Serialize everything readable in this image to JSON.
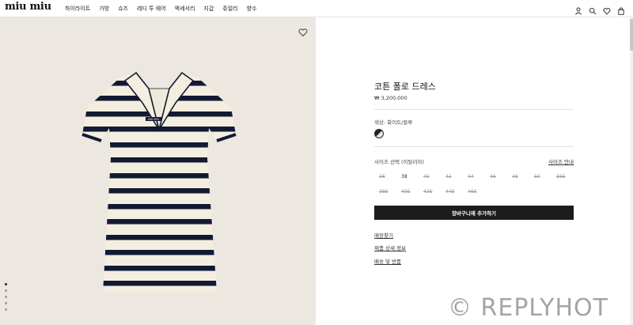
{
  "header": {
    "logo": "miu miu",
    "nav": [
      "하이라이트",
      "가방",
      "슈즈",
      "레디 투 웨어",
      "액세서리",
      "지갑",
      "쥬얼리",
      "향수"
    ],
    "icons": [
      "user-icon",
      "search-icon",
      "heart-icon",
      "bag-icon"
    ]
  },
  "product": {
    "title": "코튼 폴로 드레스",
    "price": "₩ 3,200,000",
    "color_label": "색상: 화이트/블루",
    "swatch_colors": [
      "#1b2238",
      "#e9e4d8"
    ],
    "size_label": "사이즈 선택 (이탈리아)",
    "size_guide": "사이즈 안내",
    "sizes_row1": [
      {
        "label": "36",
        "available": false
      },
      {
        "label": "38",
        "available": true
      },
      {
        "label": "40",
        "available": false
      },
      {
        "label": "42",
        "available": false
      },
      {
        "label": "44",
        "available": false
      },
      {
        "label": "46",
        "available": false
      },
      {
        "label": "48",
        "available": false
      },
      {
        "label": "50",
        "available": false
      },
      {
        "label": "36S",
        "available": false
      }
    ],
    "sizes_row2": [
      {
        "label": "38S",
        "available": false
      },
      {
        "label": "40S",
        "available": false
      },
      {
        "label": "42S",
        "available": false
      },
      {
        "label": "44S",
        "available": false
      },
      {
        "label": "46S",
        "available": false
      }
    ],
    "add_to_cart": "장바구니에 추가하기",
    "links": [
      "매장찾기",
      "제품 상세 정보",
      "배송 및 반품"
    ]
  },
  "gallery": {
    "dress_logo": "MIU MIU",
    "stripe_color": "#121933",
    "knit_color": "#f3eee0"
  },
  "watermark": "© REPLYHOT"
}
